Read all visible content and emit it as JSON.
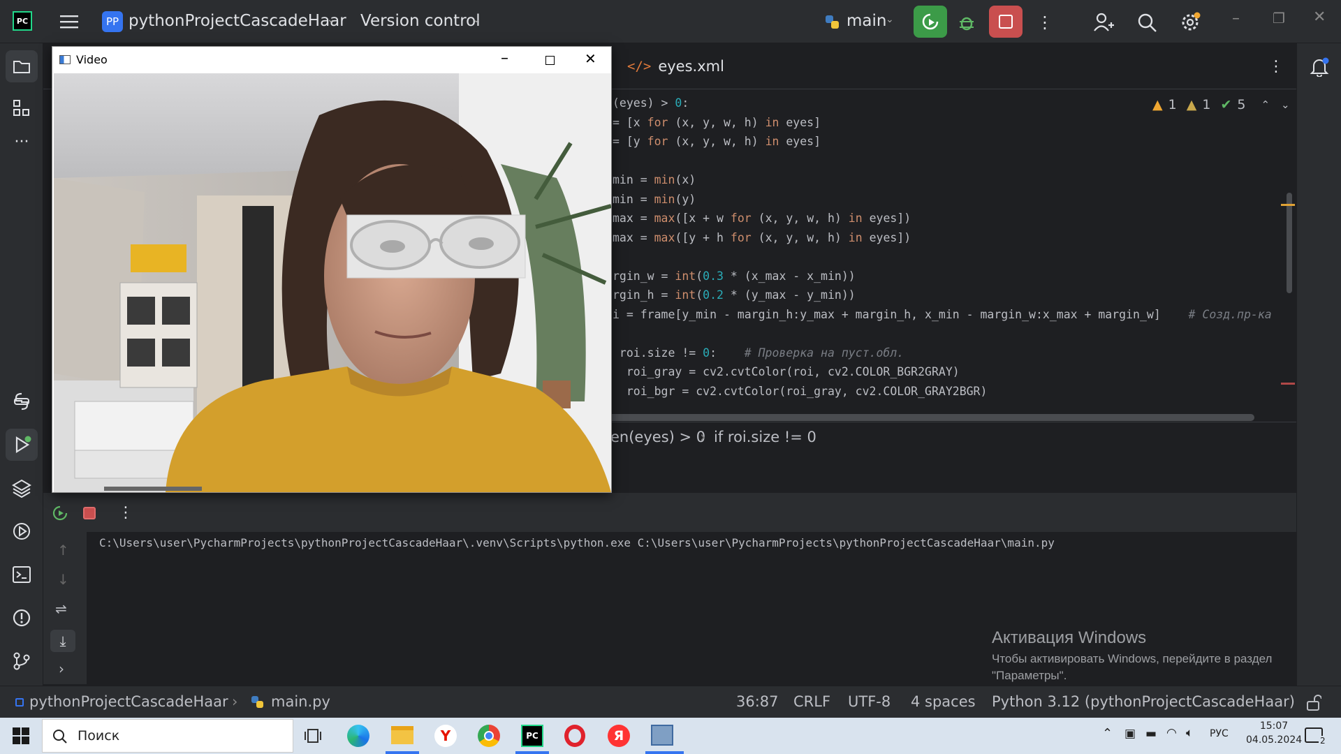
{
  "titlebar": {
    "project_badge": "PP",
    "project_name": "pythonProjectCascadeHaar",
    "version_control": "Version control",
    "branch": "main"
  },
  "editor": {
    "tab_label": "eyes.xml",
    "inspections": {
      "warn1": "1",
      "warn2": "1",
      "ok": "5"
    },
    "breadcrumb": [
      "en(eyes) > 0",
      "if roi.size != 0"
    ]
  },
  "code_lines": [
    [
      {
        "t": "(eyes) > ",
        "c": ""
      },
      {
        "t": "0",
        "c": "num"
      },
      {
        "t": ":",
        "c": ""
      }
    ],
    [
      {
        "t": "= [x ",
        "c": ""
      },
      {
        "t": "for",
        "c": "kw"
      },
      {
        "t": " (x, y, w, h) ",
        "c": ""
      },
      {
        "t": "in",
        "c": "kw"
      },
      {
        "t": " eyes]",
        "c": ""
      }
    ],
    [
      {
        "t": "= [y ",
        "c": ""
      },
      {
        "t": "for",
        "c": "kw"
      },
      {
        "t": " (x, y, w, h) ",
        "c": ""
      },
      {
        "t": "in",
        "c": "kw"
      },
      {
        "t": " eyes]",
        "c": ""
      }
    ],
    [],
    [
      {
        "t": "min = ",
        "c": ""
      },
      {
        "t": "min",
        "c": "kw"
      },
      {
        "t": "(x)",
        "c": ""
      }
    ],
    [
      {
        "t": "min = ",
        "c": ""
      },
      {
        "t": "min",
        "c": "kw"
      },
      {
        "t": "(y)",
        "c": ""
      }
    ],
    [
      {
        "t": "max = ",
        "c": ""
      },
      {
        "t": "max",
        "c": "kw"
      },
      {
        "t": "([x + w ",
        "c": ""
      },
      {
        "t": "for",
        "c": "kw"
      },
      {
        "t": " (x, y, w, h) ",
        "c": ""
      },
      {
        "t": "in",
        "c": "kw"
      },
      {
        "t": " eyes])",
        "c": ""
      }
    ],
    [
      {
        "t": "max = ",
        "c": ""
      },
      {
        "t": "max",
        "c": "kw"
      },
      {
        "t": "([y + h ",
        "c": ""
      },
      {
        "t": "for",
        "c": "kw"
      },
      {
        "t": " (x, y, w, h) ",
        "c": ""
      },
      {
        "t": "in",
        "c": "kw"
      },
      {
        "t": " eyes])",
        "c": ""
      }
    ],
    [],
    [
      {
        "t": "rgin_w = ",
        "c": ""
      },
      {
        "t": "int",
        "c": "kw"
      },
      {
        "t": "(",
        "c": ""
      },
      {
        "t": "0.3",
        "c": "num"
      },
      {
        "t": " * (x_max - x_min))",
        "c": ""
      }
    ],
    [
      {
        "t": "rgin_h = ",
        "c": ""
      },
      {
        "t": "int",
        "c": "kw"
      },
      {
        "t": "(",
        "c": ""
      },
      {
        "t": "0.2",
        "c": "num"
      },
      {
        "t": " * (y_max - y_min))",
        "c": ""
      }
    ],
    [
      {
        "t": "i = frame[y_min - margin_h:y_max + margin_h, x_min - margin_w:x_max + margin_w]    ",
        "c": ""
      },
      {
        "t": "# Созд.пр-ка",
        "c": "cm"
      }
    ],
    [],
    [
      {
        "t": " roi.size != ",
        "c": ""
      },
      {
        "t": "0",
        "c": "num"
      },
      {
        "t": ":    ",
        "c": ""
      },
      {
        "t": "# Проверка на пуст.обл.",
        "c": "cm"
      }
    ],
    [
      {
        "t": "  roi_gray = cv2.cvtColor(roi, cv2.COLOR_BGR2GRAY)",
        "c": ""
      }
    ],
    [
      {
        "t": "  roi_bgr = cv2.cvtColor(roi_gray, cv2.COLOR_GRAY2BGR)",
        "c": ""
      }
    ]
  ],
  "console": {
    "line1": "C:\\Users\\user\\PycharmProjects\\pythonProjectCascadeHaar\\.venv\\Scripts\\python.exe C:\\Users\\user\\PycharmProjects\\pythonProjectCascadeHaar\\main.py"
  },
  "watermark": {
    "title": "Активация Windows",
    "line1": "Чтобы активировать Windows, перейдите в раздел",
    "line2": "\"Параметры\"."
  },
  "statusbar": {
    "project": "pythonProjectCascadeHaar",
    "file": "main.py",
    "position": "36:87",
    "line_sep": "CRLF",
    "encoding": "UTF-8",
    "indent": "4 spaces",
    "interpreter": "Python 3.12 (pythonProjectCascadeHaar)"
  },
  "video_window": {
    "title": "Video"
  },
  "taskbar": {
    "search_placeholder": "Поиск",
    "lang": "РУС",
    "time": "15:07",
    "date": "04.05.2024",
    "notif_count": "2"
  },
  "colors": {
    "run_green": "#3c9b48",
    "stop_red": "#c94f4f",
    "accent_blue": "#3574f0"
  }
}
